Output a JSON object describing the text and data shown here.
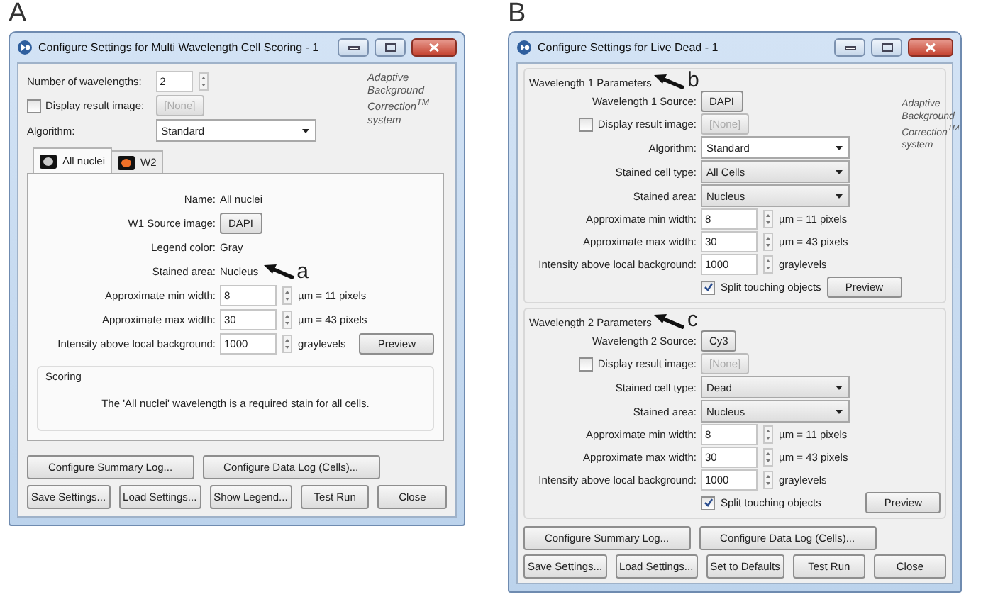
{
  "panels": [
    {
      "label": "A",
      "title": "Configure Settings for Multi Wavelength Cell Scoring - 1",
      "note": "Adaptive Background Correction$^{TM}$ system",
      "header_rows": [
        {
          "kind": "spin",
          "label": "Number of wavelengths:",
          "value": "2"
        },
        {
          "kind": "result",
          "label": "Display result image:",
          "checked": false,
          "button": "[None]",
          "disabled": true
        },
        {
          "kind": "select",
          "label": "Algorithm:",
          "value": "Standard"
        }
      ],
      "tabs": [
        {
          "label": "All nuclei",
          "selected": true,
          "color": "#c8c8c8"
        },
        {
          "label": "W2",
          "selected": false,
          "color": "#f07028"
        }
      ],
      "rows": [
        {
          "kind": "info",
          "label": "Name:",
          "value": "All nuclei"
        },
        {
          "kind": "source",
          "label": "W1 Source image:",
          "button": "DAPI"
        },
        {
          "kind": "info",
          "label": "Legend color:",
          "value": "Gray"
        },
        {
          "kind": "info",
          "label": "Stained area:",
          "value": "Nucleus",
          "annotation": "a"
        },
        {
          "kind": "spin",
          "label": "Approximate min width:",
          "value": "8",
          "unit": "µm = 11 pixels"
        },
        {
          "kind": "spin",
          "label": "Approximate max width:",
          "value": "30",
          "unit": "µm = 43 pixels"
        },
        {
          "kind": "spin",
          "label": "Intensity above local background:",
          "value": "1000",
          "unit": "graylevels",
          "button": "Preview"
        }
      ],
      "scoring": {
        "title": "Scoring",
        "text": "The 'All nuclei' wavelength is a required stain for all cells."
      },
      "button_rows": [
        [
          "Configure Summary Log...",
          "Configure Data Log (Cells)..."
        ],
        [
          "Save Settings...",
          "Load Settings...",
          "Show Legend...",
          "Test Run",
          "Close"
        ]
      ]
    },
    {
      "label": "B",
      "title": "Configure Settings for Live Dead - 1",
      "groups": [
        {
          "title": "Wavelength 1 Parameters",
          "annotation": "b",
          "note": "Adaptive Background Correction$^{TM}$ system",
          "rows": [
            {
              "kind": "source",
              "label": "Wavelength 1 Source:",
              "button": "DAPI"
            },
            {
              "kind": "result",
              "label": "Display result  image:",
              "checked": false,
              "button": "[None]",
              "disabled": true
            },
            {
              "kind": "select",
              "label": "Algorithm:",
              "value": "Standard"
            },
            {
              "kind": "select",
              "label": "Stained cell type:",
              "value": "All Cells"
            },
            {
              "kind": "select",
              "label": "Stained area:",
              "value": "Nucleus"
            },
            {
              "kind": "spin",
              "label": "Approximate min width:",
              "value": "8",
              "unit": "µm = 11 pixels"
            },
            {
              "kind": "spin",
              "label": "Approximate max width:",
              "value": "30",
              "unit": "µm = 43 pixels"
            },
            {
              "kind": "spin",
              "label": "Intensity above local background:",
              "value": "1000",
              "unit": "graylevels"
            },
            {
              "kind": "check",
              "label": "Split touching objects",
              "checked": true,
              "button": "Preview"
            }
          ]
        },
        {
          "title": "Wavelength 2 Parameters",
          "annotation": "c",
          "rows": [
            {
              "kind": "source",
              "label": "Wavelength 2 Source:",
              "button": "Cy3"
            },
            {
              "kind": "result",
              "label": "Display result  image:",
              "checked": false,
              "button": "[None]",
              "disabled": true
            },
            {
              "kind": "select",
              "label": "Stained cell type:",
              "value": "Dead"
            },
            {
              "kind": "select",
              "label": "Stained area:",
              "value": "Nucleus"
            },
            {
              "kind": "spin",
              "label": "Approximate min width:",
              "value": "8",
              "unit": "µm = 11 pixels"
            },
            {
              "kind": "spin",
              "label": "Approximate max width:",
              "value": "30",
              "unit": "µm = 43 pixels"
            },
            {
              "kind": "spin",
              "label": "Intensity above local background:",
              "value": "1000",
              "unit": "graylevels"
            },
            {
              "kind": "check",
              "label": "Split touching objects",
              "checked": true,
              "button": "Preview"
            }
          ]
        }
      ],
      "button_rows": [
        [
          "Configure Summary Log...",
          "Configure Data Log (Cells)..."
        ],
        [
          "Save Settings...",
          "Load Settings...",
          "Set to Defaults",
          "Test Run",
          "Close"
        ]
      ]
    }
  ]
}
